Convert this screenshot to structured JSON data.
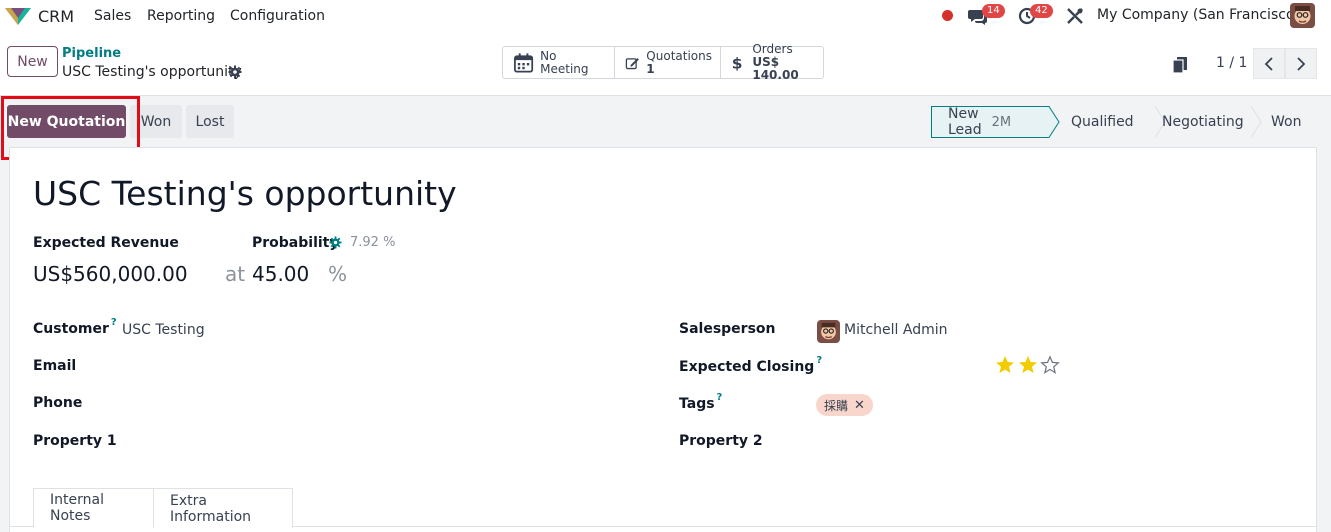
{
  "navbar": {
    "app_name": "CRM",
    "menus": [
      "Sales",
      "Reporting",
      "Configuration"
    ],
    "messages_count": "14",
    "activities_count": "42",
    "company": "My Company (San Francisco)"
  },
  "control": {
    "new_label": "New",
    "breadcrumb_parent": "Pipeline",
    "breadcrumb_current": "USC Testing's opportunity",
    "smart_buttons": [
      {
        "label": "No Meeting",
        "value": ""
      },
      {
        "label": "Quotations",
        "value": "1"
      },
      {
        "label": "Orders",
        "value": "US$ 140.00"
      }
    ],
    "pager": "1 / 1"
  },
  "statusbar": {
    "new_quotation": "New Quotation",
    "won": "Won",
    "lost": "Lost",
    "stages": [
      {
        "label": "New Lead",
        "duration": "2M"
      },
      {
        "label": "Qualified"
      },
      {
        "label": "Negotiating"
      },
      {
        "label": "Won"
      }
    ]
  },
  "form": {
    "title": "USC Testing's opportunity",
    "expected_revenue_label": "Expected Revenue",
    "expected_revenue_value": "US$560,000.00",
    "at": "at",
    "probability_label": "Probability",
    "probability_auto": "7.92 %",
    "probability_value": "45.00",
    "percent": "%",
    "customer_label": "Customer",
    "customer_value": "USC Testing",
    "email_label": "Email",
    "phone_label": "Phone",
    "property1_label": "Property 1",
    "salesperson_label": "Salesperson",
    "salesperson_value": "Mitchell Admin",
    "expected_closing_label": "Expected Closing",
    "priority_stars": 2,
    "priority_max": 3,
    "tags_label": "Tags",
    "tag": "採購",
    "property2_label": "Property 2",
    "help_mark": "?"
  },
  "tabs": [
    "Internal Notes",
    "Extra Information"
  ]
}
